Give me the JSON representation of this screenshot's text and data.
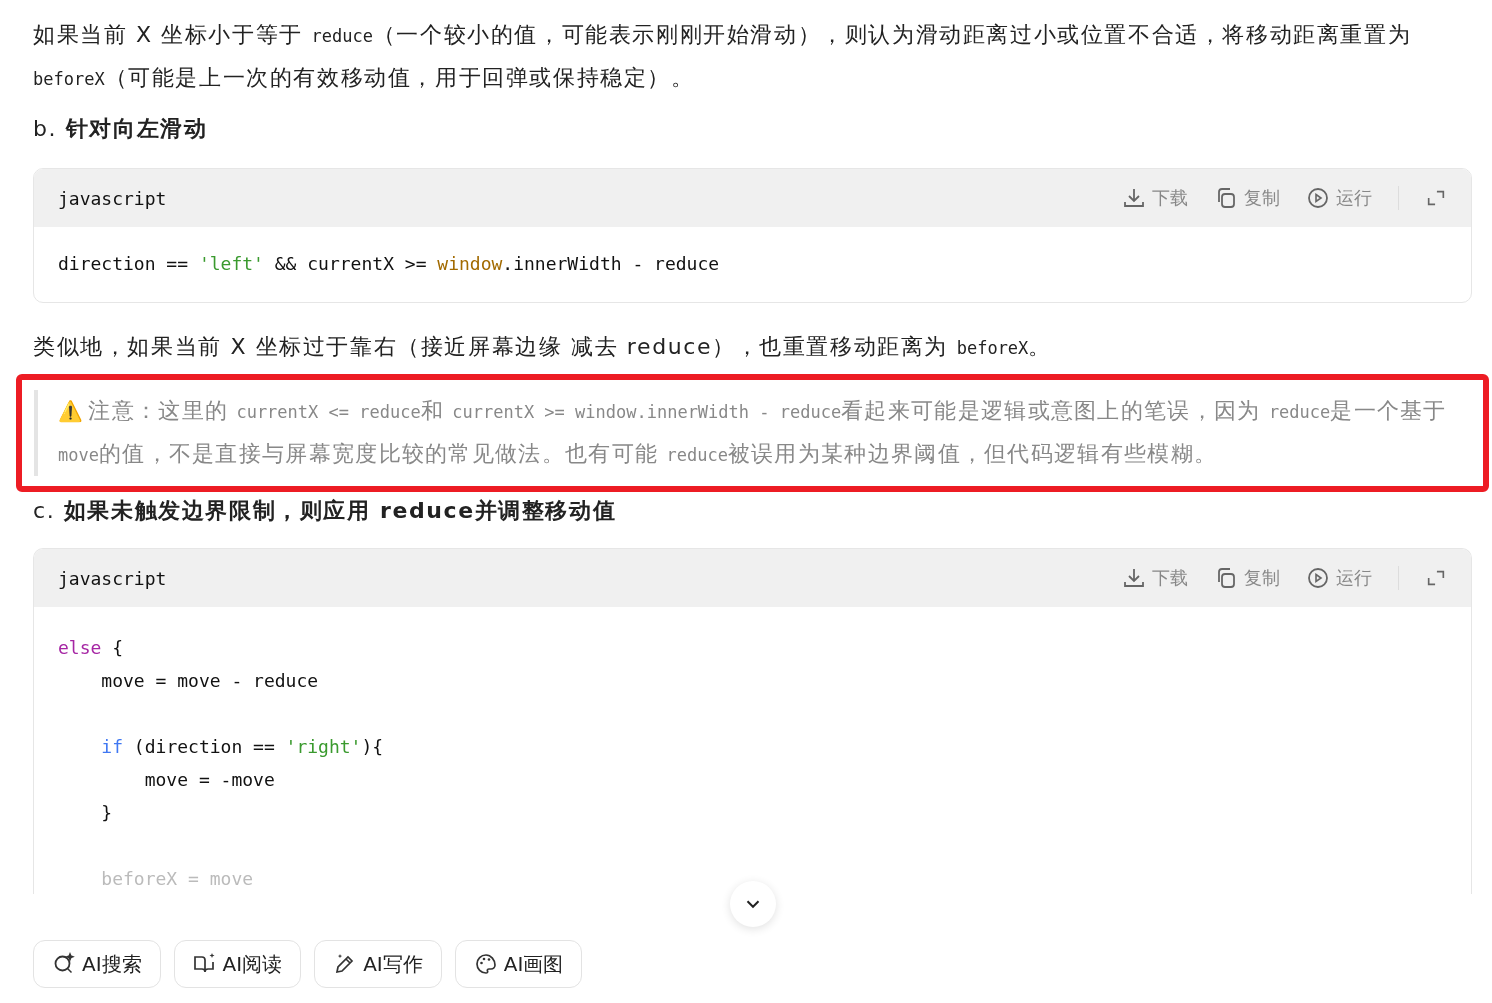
{
  "intro": [
    {
      "kind": "text",
      "text": "如果当前 X 坐标小于等于 "
    },
    {
      "kind": "code",
      "text": "reduce"
    },
    {
      "kind": "text",
      "text": "（一个较小的值，可能表示刚刚开始滑动），则认为滑动距离过小或位置不合适，将移动距离重置为 "
    },
    {
      "kind": "code",
      "text": "beforeX"
    },
    {
      "kind": "text",
      "text": "（可能是上一次的有效移动值，用于回弹或保持稳定）。"
    }
  ],
  "heading_b": [
    {
      "kind": "text",
      "text": "b. "
    },
    {
      "kind": "bold",
      "text": "针对向左滑动"
    }
  ],
  "code_a": {
    "language": "javascript",
    "actions": [
      "下载",
      "复制",
      "运行"
    ],
    "lines": [
      {
        "gap_before": false,
        "tokens": [
          {
            "kind": "plain",
            "text": "direction == "
          },
          {
            "kind": "string",
            "text": "'left'"
          },
          {
            "kind": "plain",
            "text": " && currentX >= "
          },
          {
            "kind": "builtin",
            "text": "window"
          },
          {
            "kind": "plain",
            "text": ".innerWidth - reduce"
          }
        ]
      }
    ]
  },
  "para": [
    {
      "kind": "text",
      "text": "类似地，如果当前 X 坐标过于靠右（接近屏幕边缘 减去 reduce），也重置移动距离为 "
    },
    {
      "kind": "code",
      "text": "beforeX"
    },
    {
      "kind": "text",
      "text": "。"
    }
  ],
  "note": {
    "highlighted": true,
    "icon": "⚠️",
    "segments": [
      {
        "kind": "text",
        "text": "注意：这里的 "
      },
      {
        "kind": "code",
        "text": "currentX <= reduce"
      },
      {
        "kind": "text",
        "text": "和 "
      },
      {
        "kind": "code",
        "text": "currentX >= window.innerWidth - reduce"
      },
      {
        "kind": "text",
        "text": "看起来可能是逻辑或意图上的笔误，因为 "
      },
      {
        "kind": "code",
        "text": "reduce"
      },
      {
        "kind": "text",
        "text": "是一个基于 "
      },
      {
        "kind": "code",
        "text": "move"
      },
      {
        "kind": "text",
        "text": "的值，不是直接与屏幕宽度比较的常见做法。也有可能 "
      },
      {
        "kind": "code",
        "text": "reduce"
      },
      {
        "kind": "text",
        "text": "被误用为某种边界阈值，但代码逻辑有些模糊。"
      }
    ]
  },
  "heading_c": [
    {
      "kind": "text",
      "text": "c. "
    },
    {
      "kind": "bold",
      "text": "如果未触发边界限制，则应用 reduce并调整移动值"
    }
  ],
  "code_b": {
    "language": "javascript",
    "actions": [
      "下载",
      "复制",
      "运行"
    ],
    "lines": [
      {
        "gap_before": false,
        "tokens": [
          {
            "kind": "keyword",
            "text": "else"
          },
          {
            "kind": "plain",
            "text": " {"
          }
        ]
      },
      {
        "gap_before": false,
        "tokens": [
          {
            "kind": "plain",
            "text": "    move = move - reduce"
          }
        ]
      },
      {
        "gap_before": true,
        "tokens": [
          {
            "kind": "keyword2",
            "text": "    if"
          },
          {
            "kind": "plain",
            "text": " (direction == "
          },
          {
            "kind": "string",
            "text": "'right'"
          },
          {
            "kind": "plain",
            "text": "){"
          }
        ]
      },
      {
        "gap_before": false,
        "tokens": [
          {
            "kind": "plain",
            "text": "        move = -move"
          }
        ]
      },
      {
        "gap_before": false,
        "tokens": [
          {
            "kind": "plain",
            "text": "    }"
          }
        ]
      },
      {
        "gap_before": true,
        "tokens": [
          {
            "kind": "plain",
            "text": "    beforeX = move"
          }
        ]
      }
    ]
  },
  "tools": [
    {
      "kind": "search",
      "label": "AI搜索"
    },
    {
      "kind": "read",
      "label": "AI阅读"
    },
    {
      "kind": "write",
      "label": "AI写作"
    },
    {
      "kind": "draw",
      "label": "AI画图"
    }
  ]
}
